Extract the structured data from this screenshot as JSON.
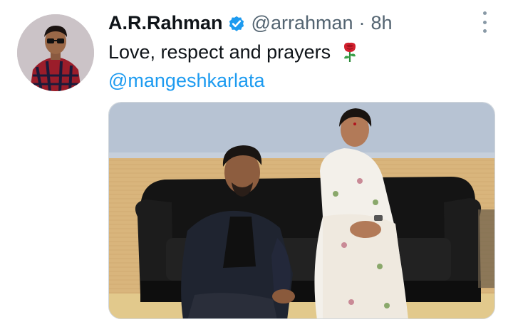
{
  "tweet": {
    "display_name": "A.R.Rahman",
    "handle": "@arrahman",
    "separator": "·",
    "time": "8h",
    "text": "Love, respect and prayers",
    "mention": "@mangeshkarlata",
    "emoji_icon": "rose-icon",
    "verified_icon": "verified-badge-icon",
    "more_icon": "more-options-icon"
  },
  "colors": {
    "name": "#0f1419",
    "secondary": "#536471",
    "link": "#1d9bf0",
    "verified": "#1d9bf0"
  }
}
